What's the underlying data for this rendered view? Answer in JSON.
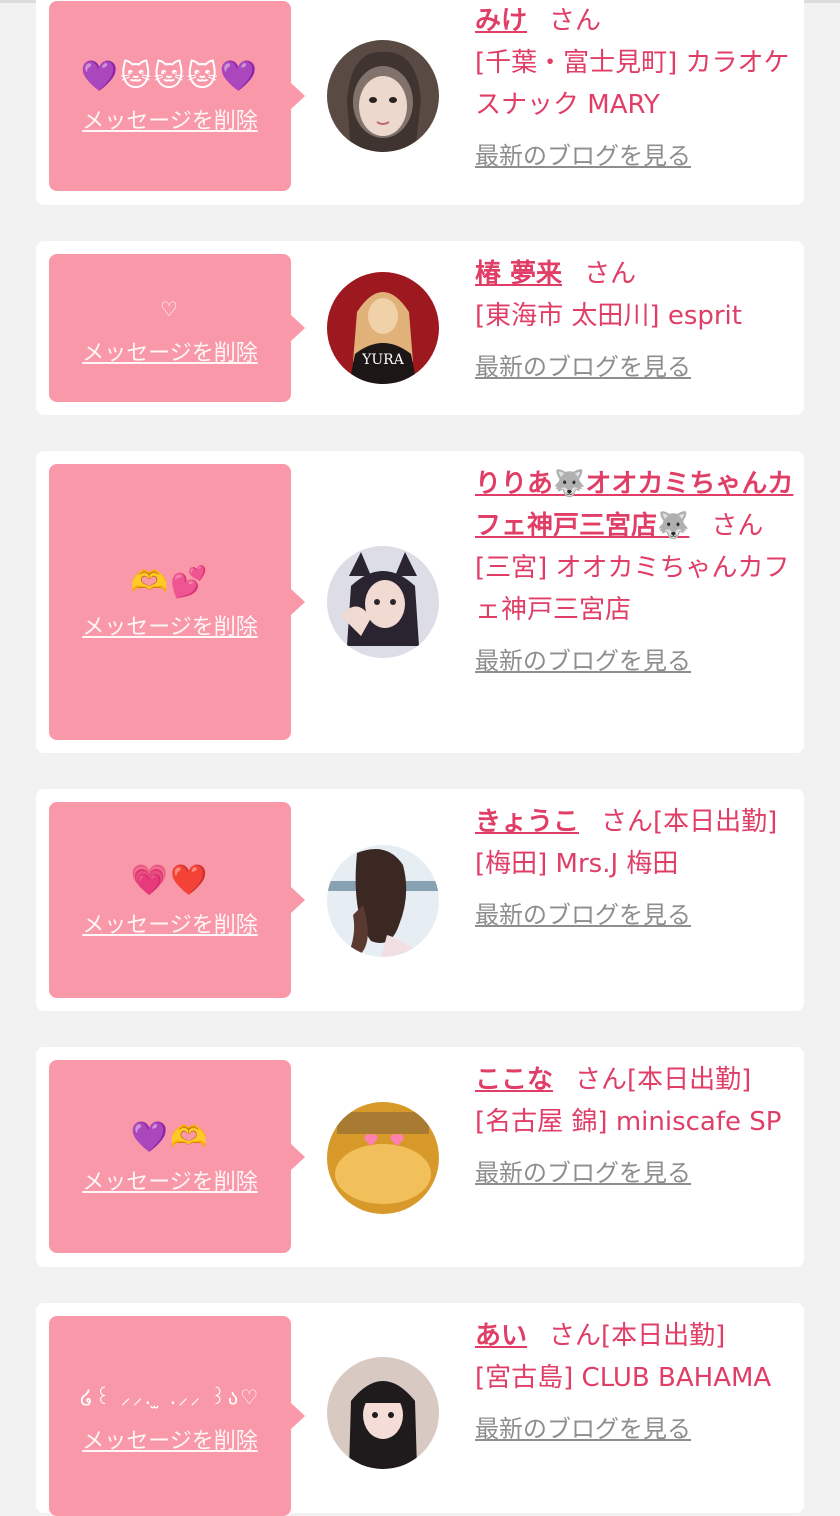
{
  "cards": [
    {
      "emoji": "💜🐱🐱🐱💜",
      "delete_label": "メッセージを削除",
      "name": "みけ",
      "honorific": "さん",
      "shop": "[千葉・富士見町] カラオケスナック MARY",
      "blog_label": "最新のブログを見る",
      "avatar_colors": [
        "#5a4a44",
        "#e8d2c6",
        "#2b2220"
      ]
    },
    {
      "emoji": "♡",
      "delete_label": "メッセージを削除",
      "name": "椿 夢来",
      "honorific": "さん",
      "shop": "[東海市 太田川] esprit",
      "blog_label": "最新のブログを見る",
      "avatar_colors": [
        "#9e1820",
        "#f1d1a8",
        "#1d1616"
      ],
      "avatar_text": "YURA"
    },
    {
      "emoji": "🫶💕",
      "delete_label": "メッセージを削除",
      "name": "りりあ🐺オオカミちゃんカフェ神戸三宮店🐺",
      "honorific": "さん",
      "shop": "[三宮] オオカミちゃんカフェ神戸三宮店",
      "blog_label": "最新のブログを見る",
      "avatar_colors": [
        "#dcdde6",
        "#f1dad2",
        "#2a2430"
      ]
    },
    {
      "emoji": "💗❤️",
      "delete_label": "メッセージを削除",
      "name": "きょうこ",
      "honorific": "さん",
      "status": "[本日出勤]",
      "shop": "[梅田] Mrs.J 梅田",
      "blog_label": "最新のブログを見る",
      "avatar_colors": [
        "#e7eef3",
        "#3b2823",
        "#f2dfe4"
      ]
    },
    {
      "emoji": "💜🫶",
      "delete_label": "メッセージを削除",
      "name": "ここな",
      "honorific": "さん",
      "status": "[本日出勤]",
      "shop": "[名古屋 錦] miniscafe SP",
      "blog_label": "最新のブログを見る",
      "avatar_colors": [
        "#d79a2a",
        "#f1c05a",
        "#ff7fb0"
      ]
    },
    {
      "emoji": "໒꒰ ⸝⸝. ̫ .⸝⸝ ꒱ა♡",
      "delete_label": "メッセージを削除",
      "name": "あい",
      "honorific": "さん",
      "status": "[本日出勤]",
      "shop": "[宮古島] CLUB BAHAMA",
      "blog_label": "最新のブログを見る",
      "avatar_colors": [
        "#d8c9c2",
        "#f3ddd6",
        "#1f1a1c"
      ]
    }
  ]
}
